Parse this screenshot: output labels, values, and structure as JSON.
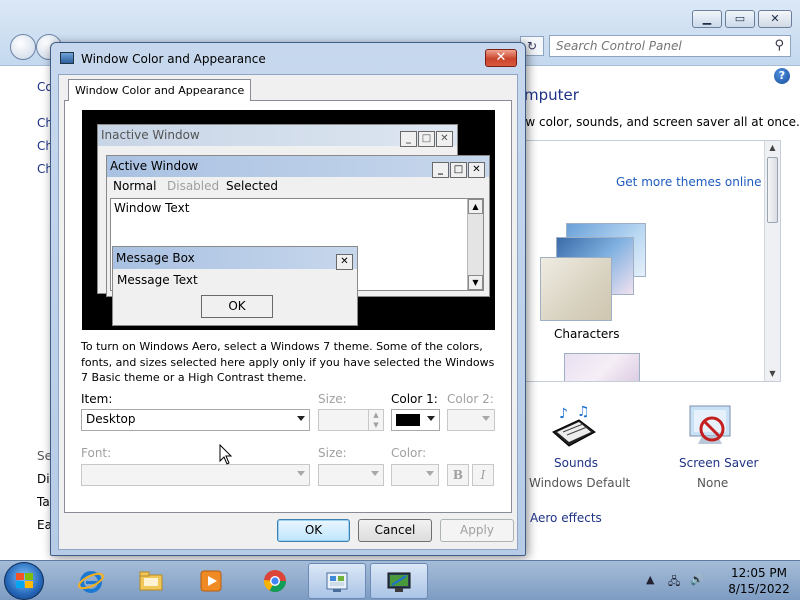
{
  "control_panel": {
    "search_placeholder": "Search Control Panel",
    "left_items": [
      "Co",
      "Ch",
      "Ch",
      "Ch"
    ],
    "left_see_also": [
      "Se",
      "Dis",
      "Ta",
      "Ea"
    ],
    "heading": "mputer",
    "description": "ow color, sounds, and screen saver all at once.",
    "get_more_themes": "Get more themes online",
    "theme_name": "Characters",
    "sounds_label": "Sounds",
    "sounds_value": "Windows Default",
    "screensaver_label": "Screen Saver",
    "screensaver_value": "None",
    "aero_link": "Aero effects"
  },
  "dialog": {
    "title": "Window Color and Appearance",
    "tab_label": "Window Color and Appearance",
    "close_glyph": "✕",
    "preview": {
      "inactive_title": "Inactive Window",
      "active_title": "Active Window",
      "menu_normal": "Normal",
      "menu_disabled": "Disabled",
      "menu_selected": "Selected",
      "window_text": "Window Text",
      "msgbox_title": "Message Box",
      "msgbox_text": "Message Text",
      "msgbox_ok": "OK",
      "btn_min": "_",
      "btn_max": "□",
      "btn_close": "✕"
    },
    "instructions": "To turn on Windows Aero, select a Windows 7 theme.  Some of the colors, fonts, and sizes selected here apply only if you have selected the Windows 7 Basic theme or a High Contrast theme.",
    "item_label": "Item:",
    "item_value": "Desktop",
    "size_label": "Size:",
    "color1_label": "Color 1:",
    "color2_label": "Color 2:",
    "color1_value": "#000000",
    "font_label": "Font:",
    "font_size_label": "Size:",
    "font_color_label": "Color:",
    "bold_label": "B",
    "italic_label": "I",
    "ok": "OK",
    "cancel": "Cancel",
    "apply": "Apply"
  },
  "taskbar": {
    "time": "12:05 PM",
    "date": "8/15/2022",
    "apps": [
      "start-orb",
      "internet-explorer-icon",
      "file-explorer-icon",
      "media-player-icon",
      "chrome-icon",
      "control-panel-icon",
      "display-settings-icon"
    ]
  }
}
